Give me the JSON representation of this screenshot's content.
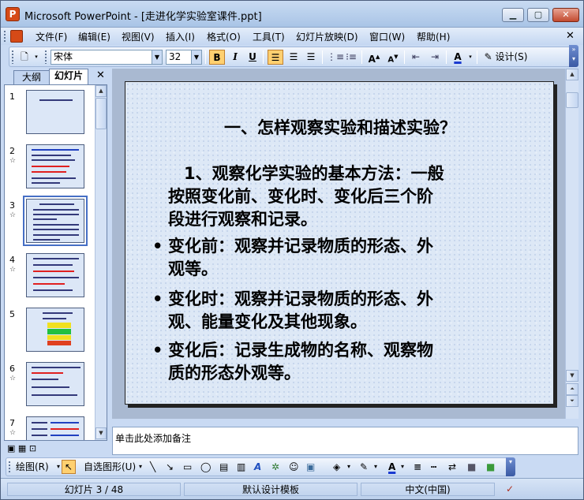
{
  "window": {
    "title": "Microsoft PowerPoint - [走进化学实验室课件.ppt]",
    "controls": {
      "minimize": "▁",
      "maximize": "▢",
      "close": "✕"
    }
  },
  "menu": {
    "items": [
      "文件(F)",
      "编辑(E)",
      "视图(V)",
      "插入(I)",
      "格式(O)",
      "工具(T)",
      "幻灯片放映(D)",
      "窗口(W)",
      "帮助(H)"
    ],
    "close": "✕"
  },
  "toolbar": {
    "font": "宋体",
    "size": "32",
    "bold": "B",
    "italic": "I",
    "underline": "U",
    "design": "设计(S)"
  },
  "left_pane": {
    "tabs": [
      "大纲",
      "幻灯片"
    ],
    "close": "✕",
    "slides": [
      {
        "num": "1",
        "star": ""
      },
      {
        "num": "2",
        "star": "☆"
      },
      {
        "num": "3",
        "star": "☆"
      },
      {
        "num": "4",
        "star": "☆"
      },
      {
        "num": "5",
        "star": ""
      },
      {
        "num": "6",
        "star": "☆"
      },
      {
        "num": "7",
        "star": "☆"
      }
    ]
  },
  "slide": {
    "title": "一、怎样观察实验和描述实验？",
    "intro_lines": [
      "1、观察化学实验的基本方法：一般",
      "按照变化前、变化时、变化后三个阶",
      "段进行观察和记录。"
    ],
    "bullets": [
      {
        "mark": "•",
        "lines": [
          "变化前：观察并记录物质的形态、外",
          "观等。"
        ]
      },
      {
        "mark": "•",
        "lines": [
          "变化时：观察并记录物质的形态、外",
          "观、能量变化及其他现象。"
        ]
      },
      {
        "mark": "•",
        "lines": [
          "变化后：记录生成物的名称、观察物",
          "质的形态外观等。"
        ]
      }
    ]
  },
  "notes": {
    "placeholder": "单击此处添加备注"
  },
  "drawing_toolbar": {
    "draw": "绘图(R)",
    "autoshapes": "自选图形(U)"
  },
  "status": {
    "slide": "幻灯片 3 / 48",
    "template": "默认设计模板",
    "language": "中文(中国)"
  },
  "colors": {
    "accent": "#466fc5",
    "chrome": "#c9daf3",
    "slide_bg": "#dde8f6"
  }
}
